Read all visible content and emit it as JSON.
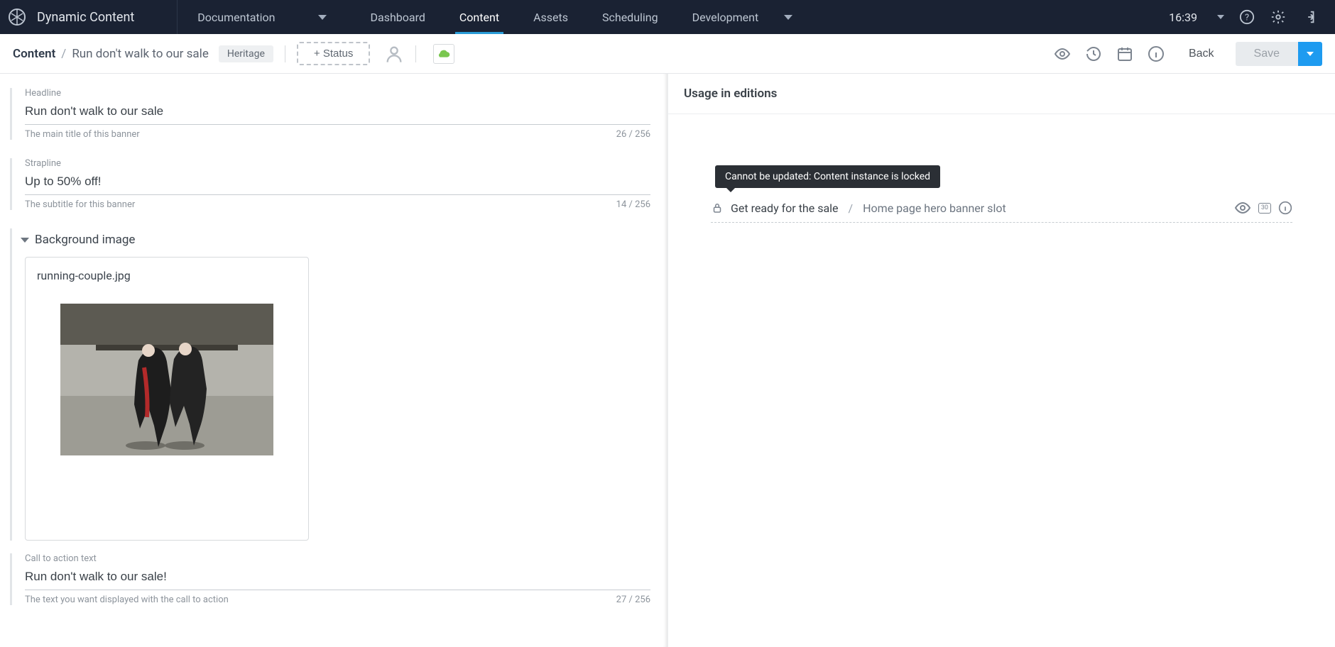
{
  "topnav": {
    "brand": "Dynamic Content",
    "doc_dropdown": "Documentation",
    "tabs": {
      "dashboard": "Dashboard",
      "content": "Content",
      "assets": "Assets",
      "scheduling": "Scheduling"
    },
    "development": "Development",
    "time": "16:39"
  },
  "toolbar": {
    "crumb_root": "Content",
    "crumb_sep": "/",
    "crumb_leaf": "Run don't walk to our sale",
    "badge": "Heritage",
    "status_btn": "+ Status",
    "back": "Back",
    "save": "Save"
  },
  "form": {
    "headline": {
      "label": "Headline",
      "value": "Run don't walk to our sale",
      "help": "The main title of this banner",
      "count": "26 / 256"
    },
    "strapline": {
      "label": "Strapline",
      "value": "Up to 50% off!",
      "help": "The subtitle for this banner",
      "count": "14 / 256"
    },
    "bgimage": {
      "section": "Background image",
      "filename": "running-couple.jpg"
    },
    "cta": {
      "label": "Call to action text",
      "value": "Run don't walk to our sale!",
      "help": "The text you want displayed with the call to action",
      "count": "27 / 256"
    }
  },
  "panel": {
    "title": "Usage in editions",
    "tooltip": "Cannot be updated: Content instance is locked",
    "edition_name": "Get ready for the sale",
    "edition_sep": "/",
    "slot_name": "Home page hero banner slot",
    "cal_day": "30"
  }
}
